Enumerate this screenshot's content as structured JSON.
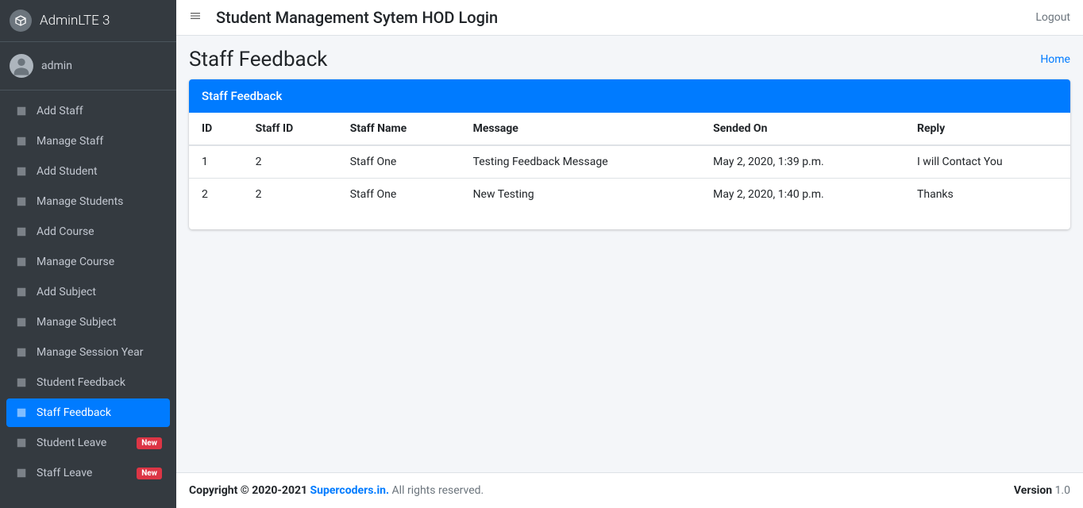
{
  "brand": "AdminLTE 3",
  "user": {
    "name": "admin"
  },
  "sidebar": {
    "items": [
      {
        "label": "Add Staff",
        "active": false,
        "badge": null
      },
      {
        "label": "Manage Staff",
        "active": false,
        "badge": null
      },
      {
        "label": "Add Student",
        "active": false,
        "badge": null
      },
      {
        "label": "Manage Students",
        "active": false,
        "badge": null
      },
      {
        "label": "Add Course",
        "active": false,
        "badge": null
      },
      {
        "label": "Manage Course",
        "active": false,
        "badge": null
      },
      {
        "label": "Add Subject",
        "active": false,
        "badge": null
      },
      {
        "label": "Manage Subject",
        "active": false,
        "badge": null
      },
      {
        "label": "Manage Session Year",
        "active": false,
        "badge": null
      },
      {
        "label": "Student Feedback",
        "active": false,
        "badge": null
      },
      {
        "label": "Staff Feedback",
        "active": true,
        "badge": null
      },
      {
        "label": "Student Leave",
        "active": false,
        "badge": "New"
      },
      {
        "label": "Staff Leave",
        "active": false,
        "badge": "New"
      }
    ]
  },
  "navbar": {
    "title": "Student Management Sytem HOD Login",
    "logout": "Logout"
  },
  "page": {
    "title": "Staff Feedback",
    "breadcrumb_home": "Home"
  },
  "card": {
    "title": "Staff Feedback",
    "columns": [
      "ID",
      "Staff ID",
      "Staff Name",
      "Message",
      "Sended On",
      "Reply"
    ],
    "rows": [
      {
        "id": "1",
        "staff_id": "2",
        "staff_name": "Staff One",
        "message": "Testing Feedback Message",
        "sended_on": "May 2, 2020, 1:39 p.m.",
        "reply": "I will Contact You"
      },
      {
        "id": "2",
        "staff_id": "2",
        "staff_name": "Staff One",
        "message": "New Testing",
        "sended_on": "May 2, 2020, 1:40 p.m.",
        "reply": "Thanks"
      }
    ]
  },
  "footer": {
    "copyright_prefix": "Copyright © 2020-2021 ",
    "link": "Supercoders.in.",
    "suffix": " All rights reserved.",
    "version_label": "Version",
    "version": " 1.0"
  }
}
